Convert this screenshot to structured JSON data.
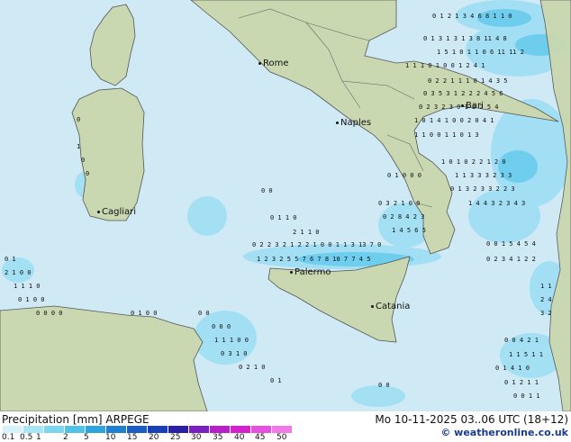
{
  "cities": [
    {
      "name": "Rome"
    },
    {
      "name": "Naples"
    },
    {
      "name": "Bari"
    },
    {
      "name": "Cagliari"
    },
    {
      "name": "Palermo"
    },
    {
      "name": "Catania"
    }
  ],
  "footer": {
    "title": "Precipitation [mm] ARPEGE",
    "datetime": "Mo 10-11-2025 03..06 UTC (18+12)",
    "credit": "© weatheronline.co.uk"
  },
  "legend": {
    "labels": [
      "0.1",
      "0.5",
      "1",
      "2",
      "5",
      "10",
      "15",
      "20",
      "25",
      "30",
      "35",
      "40",
      "45",
      "50"
    ],
    "colors": [
      "#d6f3fb",
      "#a8e6f5",
      "#7dd6ef",
      "#4fc2e6",
      "#2da4dc",
      "#1f7fd0",
      "#1b5fc6",
      "#1840b8",
      "#2a1fa8",
      "#7a1fc0",
      "#b81fc8",
      "#d81fd0",
      "#e84fe0",
      "#f27ae8"
    ]
  }
}
